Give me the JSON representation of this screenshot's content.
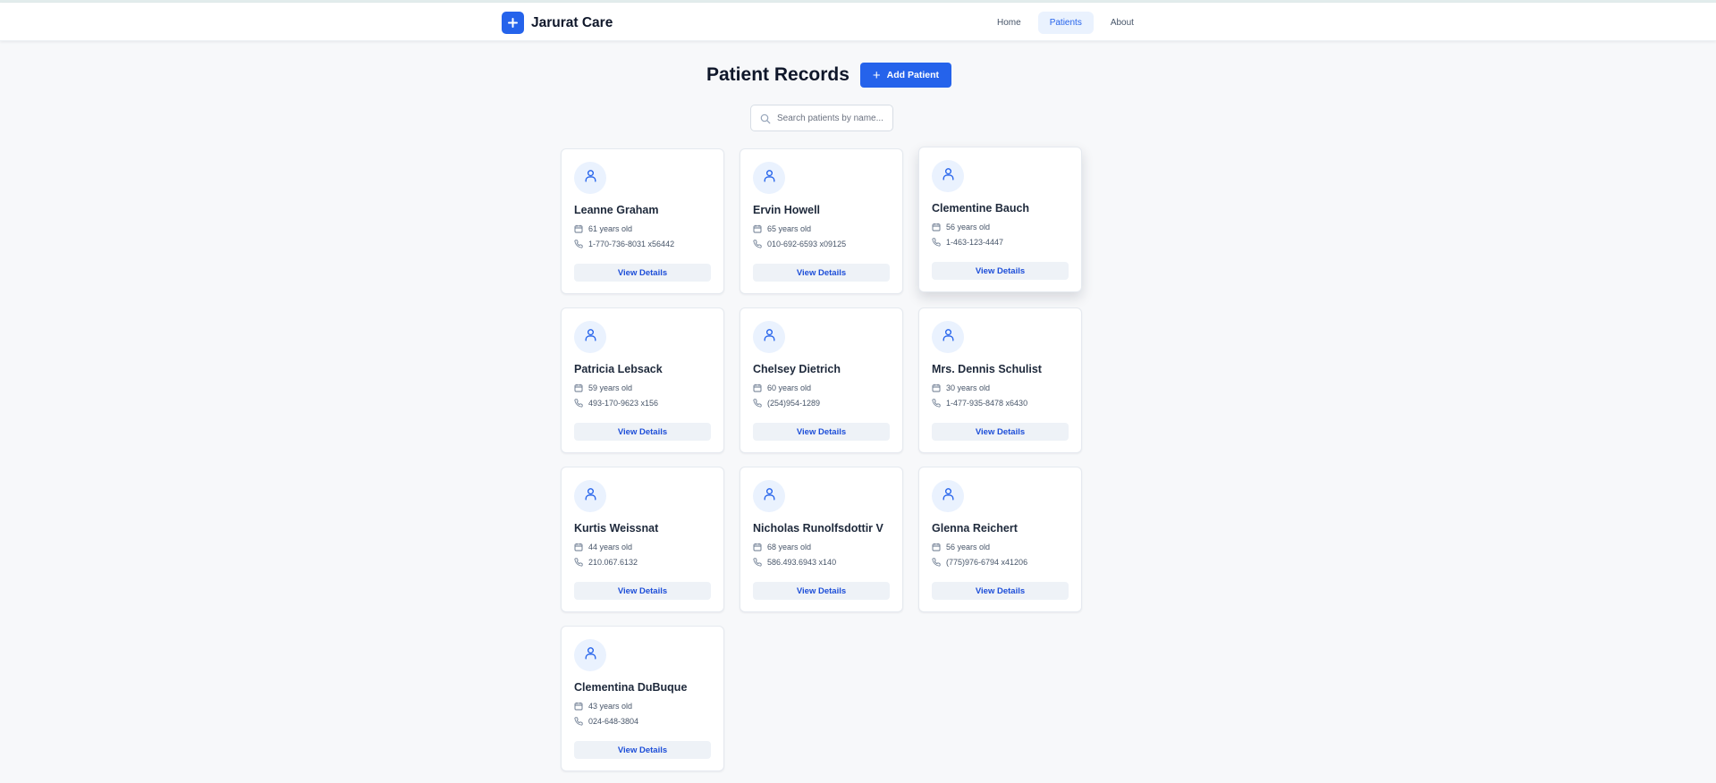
{
  "app": {
    "name": "Jarurat Care"
  },
  "nav": {
    "items": [
      {
        "label": "Home"
      },
      {
        "label": "Patients"
      },
      {
        "label": "About"
      }
    ]
  },
  "page": {
    "title": "Patient Records",
    "add_button": "Add Patient"
  },
  "search": {
    "placeholder": "Search patients by name..."
  },
  "patients": [
    {
      "name": "Leanne Graham",
      "age": "61 years old",
      "phone": "1-770-736-8031 x56442"
    },
    {
      "name": "Ervin Howell",
      "age": "65 years old",
      "phone": "010-692-6593 x09125"
    },
    {
      "name": "Clementine Bauch",
      "age": "56 years old",
      "phone": "1-463-123-4447"
    },
    {
      "name": "Patricia Lebsack",
      "age": "59 years old",
      "phone": "493-170-9623 x156"
    },
    {
      "name": "Chelsey Dietrich",
      "age": "60 years old",
      "phone": "(254)954-1289"
    },
    {
      "name": "Mrs. Dennis Schulist",
      "age": "30 years old",
      "phone": "1-477-935-8478 x6430"
    },
    {
      "name": "Kurtis Weissnat",
      "age": "44 years old",
      "phone": "210.067.6132"
    },
    {
      "name": "Nicholas Runolfsdottir V",
      "age": "68 years old",
      "phone": "586.493.6943 x140"
    },
    {
      "name": "Glenna Reichert",
      "age": "56 years old",
      "phone": "(775)976-6794 x41206"
    },
    {
      "name": "Clementina DuBuque",
      "age": "43 years old",
      "phone": "024-648-3804"
    }
  ],
  "card": {
    "view_label": "View Details"
  },
  "colors": {
    "accent": "#2563eb",
    "accent_light": "#eaf2fe",
    "background": "#f7f8fa",
    "text": "#1e293b"
  }
}
